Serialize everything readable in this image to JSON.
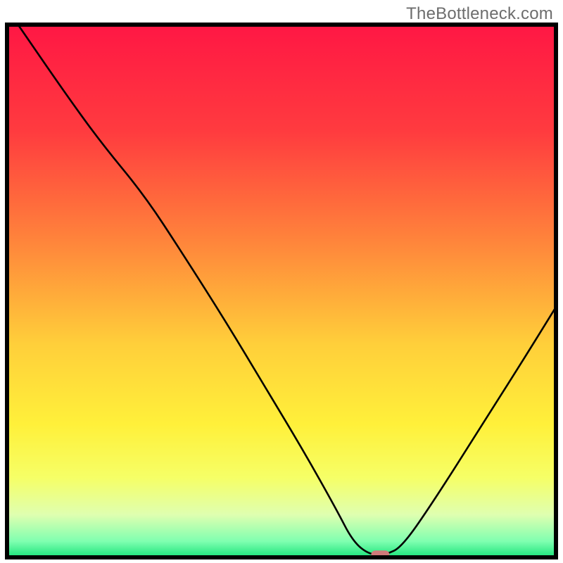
{
  "watermark": "TheBottleneck.com",
  "chart_data": {
    "type": "line",
    "title": "",
    "xlabel": "",
    "ylabel": "",
    "xlim": [
      0,
      100
    ],
    "ylim": [
      0,
      100
    ],
    "grid": false,
    "legend": false,
    "series": [
      {
        "name": "curve",
        "x": [
          2,
          10,
          17,
          25,
          32,
          40,
          47,
          54,
          60,
          63,
          66,
          69,
          72,
          78,
          86,
          94,
          100
        ],
        "values": [
          100,
          88,
          78,
          68,
          57,
          44,
          32,
          20,
          9,
          3,
          0.5,
          0.5,
          2,
          11,
          24,
          37,
          47
        ]
      }
    ],
    "marker": {
      "x": 68,
      "y": 0.5,
      "color": "#cf7a7a"
    },
    "gradient_stops": [
      {
        "offset": 0,
        "color": "#ff1744"
      },
      {
        "offset": 20,
        "color": "#ff3b3f"
      },
      {
        "offset": 40,
        "color": "#ff823b"
      },
      {
        "offset": 60,
        "color": "#ffcf3a"
      },
      {
        "offset": 75,
        "color": "#fff03a"
      },
      {
        "offset": 85,
        "color": "#f6ff66"
      },
      {
        "offset": 92,
        "color": "#dfffb0"
      },
      {
        "offset": 97,
        "color": "#7fffb0"
      },
      {
        "offset": 100,
        "color": "#19e37a"
      }
    ],
    "frame_color": "#000000",
    "line_color": "#000000",
    "line_width": 2.6
  }
}
